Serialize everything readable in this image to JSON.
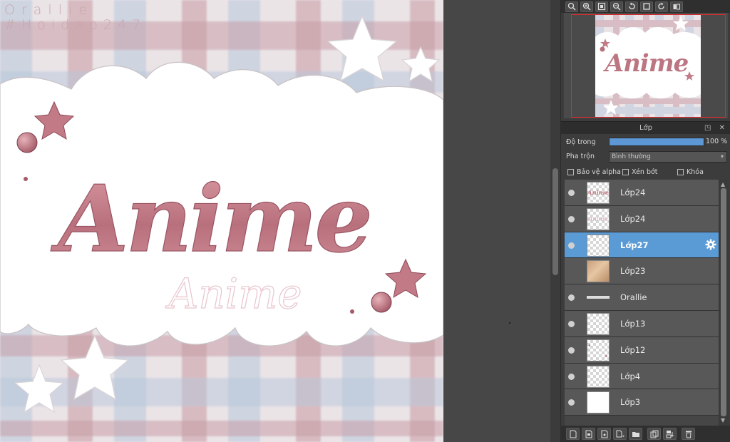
{
  "watermark": {
    "line1": "Orallie",
    "line2": "#Hoidap247"
  },
  "artwork": {
    "title_main": "Anime",
    "title_shadow": "Anime"
  },
  "navigator": {
    "tools": [
      "zoom-icon",
      "zoom-in-icon",
      "fit-window-icon",
      "zoom-out-icon",
      "rotate-left-icon",
      "actual-size-icon",
      "rotate-right-icon",
      "flip-icon"
    ],
    "frame_color": "#e02a2a"
  },
  "layer_panel": {
    "title": "Lớp",
    "title_buttons": "◳ ✕",
    "opacity_label": "Độ trong",
    "opacity_value": "100 %",
    "opacity_percent": 100,
    "blend_label": "Pha trộn",
    "blend_value": "Bình thường",
    "checkboxes": [
      {
        "label": "Bảo vệ alpha",
        "checked": false
      },
      {
        "label": "Xén bớt",
        "checked": false
      },
      {
        "label": "Khóa",
        "checked": false
      }
    ],
    "layers": [
      {
        "name": "Lớp24",
        "visible": true,
        "selected": false,
        "thumb": "text"
      },
      {
        "name": "Lớp24",
        "visible": true,
        "selected": false,
        "thumb": "text"
      },
      {
        "name": "Lớp27",
        "visible": true,
        "selected": true,
        "thumb": "empty"
      },
      {
        "name": "Lớp23",
        "visible": false,
        "selected": false,
        "thumb": "texture"
      },
      {
        "name": "Orallie",
        "visible": true,
        "selected": false,
        "thumb": "line"
      },
      {
        "name": "Lớp13",
        "visible": true,
        "selected": false,
        "thumb": "empty"
      },
      {
        "name": "Lớp12",
        "visible": true,
        "selected": false,
        "thumb": "dots"
      },
      {
        "name": "Lớp4",
        "visible": true,
        "selected": false,
        "thumb": "empty"
      },
      {
        "name": "Lớp3",
        "visible": true,
        "selected": false,
        "thumb": "empty"
      }
    ],
    "bottom_tools": [
      "new-layer-icon",
      "new-raster-icon",
      "new-halftone-icon",
      "add-layer-dropdown-icon",
      "new-folder-icon",
      "duplicate-layer-icon",
      "merge-layer-icon",
      "delete-layer-icon"
    ]
  },
  "colors": {
    "accent": "#5b9bd5",
    "title_pink": "#c47b86",
    "panel_bg": "#3c3c3c",
    "workspace_bg": "#474747"
  }
}
